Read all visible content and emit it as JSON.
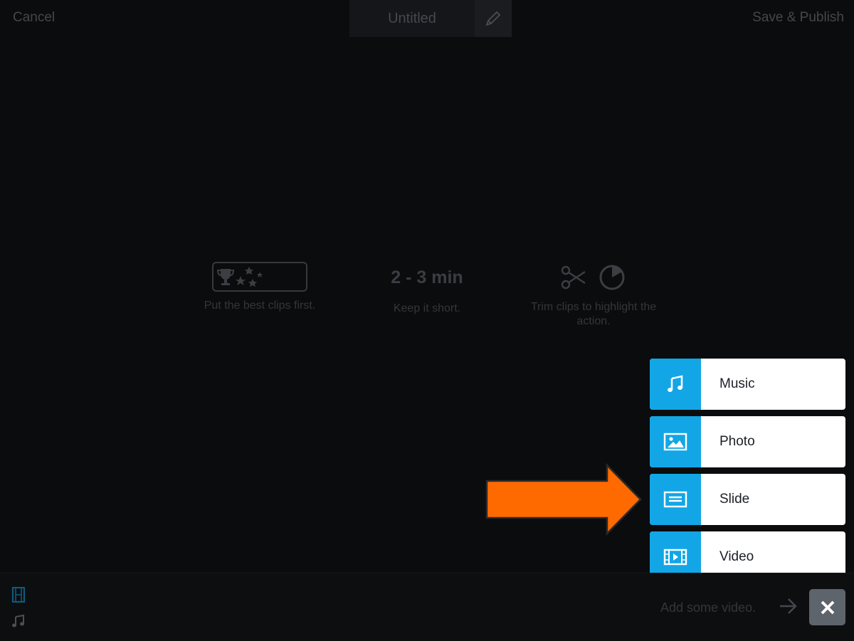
{
  "header": {
    "cancel_label": "Cancel",
    "title": "Untitled",
    "save_label": "Save & Publish"
  },
  "tips": [
    {
      "caption": "Put the best clips first."
    },
    {
      "headline": "2 - 3 min",
      "caption": "Keep it short."
    },
    {
      "caption_line1": "Trim clips to highlight the",
      "caption_line2": "action."
    }
  ],
  "add_menu": {
    "items": [
      {
        "label": "Music",
        "icon": "music-note-icon"
      },
      {
        "label": "Photo",
        "icon": "photo-icon"
      },
      {
        "label": "Slide",
        "icon": "slide-icon"
      },
      {
        "label": "Video",
        "icon": "video-icon"
      }
    ]
  },
  "timeline": {
    "hint": "Add some video.",
    "track_icons": [
      "film-strip-icon",
      "music-note-icon"
    ]
  },
  "colors": {
    "accent": "#12a6e6",
    "callout_arrow": "#ff6a00",
    "background": "#0b0c0e"
  }
}
